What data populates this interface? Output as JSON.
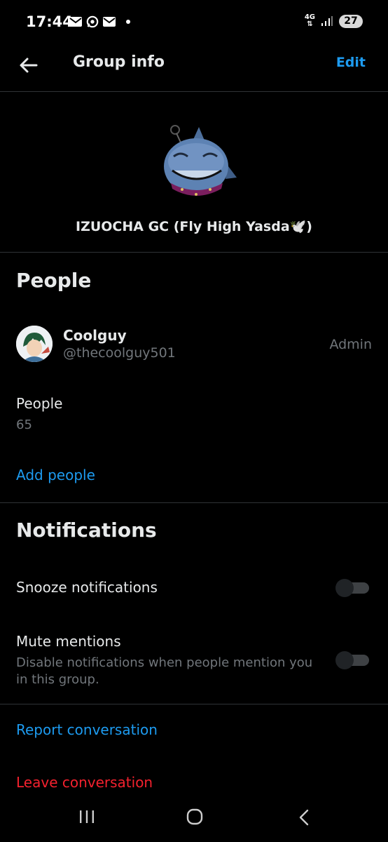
{
  "status_bar": {
    "time": "17:44",
    "network": "4G",
    "battery": "27"
  },
  "header": {
    "title": "Group info",
    "edit_label": "Edit"
  },
  "group": {
    "name": "IZUOCHA GC (Fly High Yasda🕊️)"
  },
  "people_section": {
    "title": "People",
    "members": [
      {
        "name": "Coolguy",
        "handle": "@thecoolguy501",
        "role": "Admin"
      }
    ],
    "count_label": "People",
    "count": "65",
    "add_label": "Add people"
  },
  "notifications_section": {
    "title": "Notifications",
    "snooze_label": "Snooze notifications",
    "snooze_enabled": false,
    "mute_label": "Mute mentions",
    "mute_desc": "Disable notifications when people mention you in this group.",
    "mute_enabled": false
  },
  "actions": {
    "report_label": "Report conversation",
    "leave_label": "Leave conversation"
  },
  "colors": {
    "accent": "#1d9bf0",
    "danger": "#f4212e",
    "background": "#000000"
  }
}
